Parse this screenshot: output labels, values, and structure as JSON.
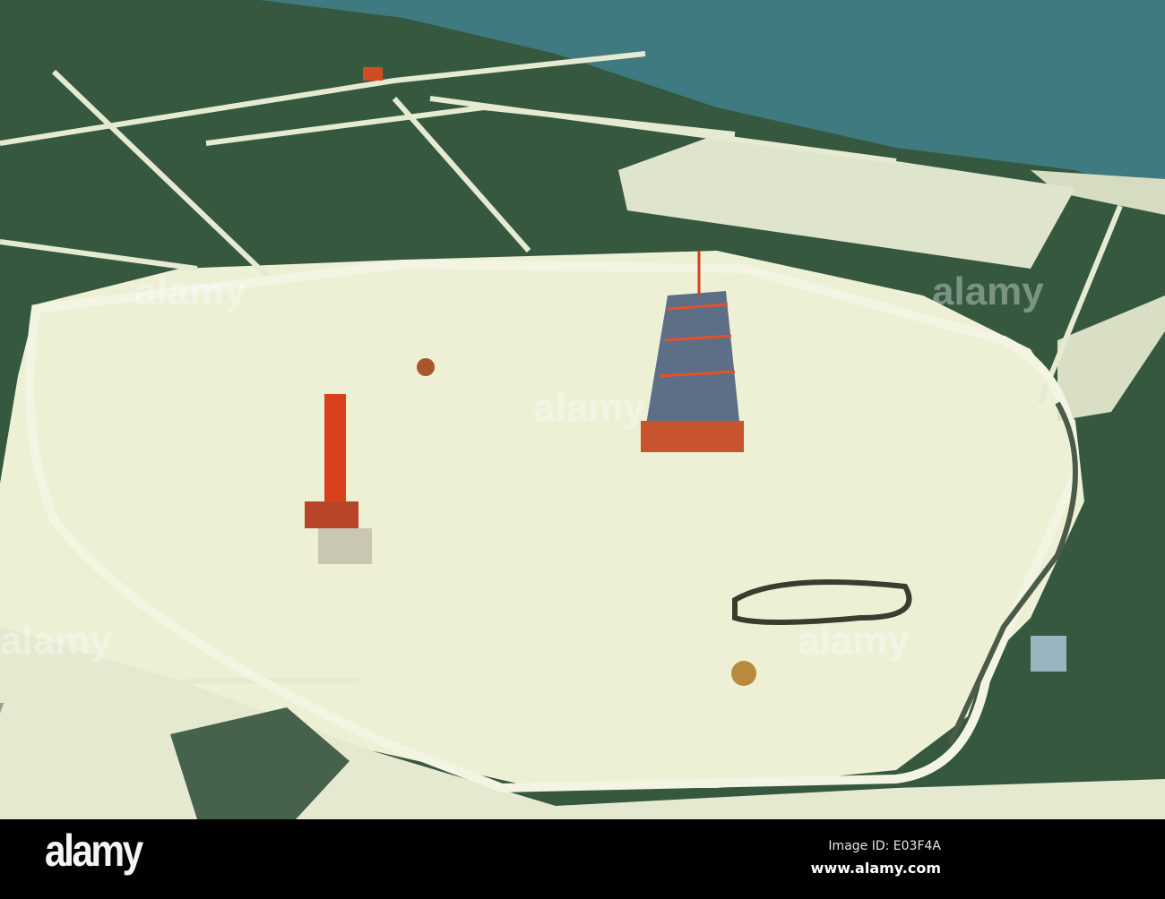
{
  "photo": {
    "subject": "aerial launch complex",
    "watermark_text": "alamy"
  },
  "footer": {
    "logo": "alamy",
    "image_id": "Image ID: E03F4A",
    "website": "www.alamy.com"
  },
  "colors": {
    "ocean": "#3f7a80",
    "land": "#2f5443",
    "sand": "#eef0d6",
    "tower_orange": "#d9401c",
    "footer_bg": "#000000"
  }
}
